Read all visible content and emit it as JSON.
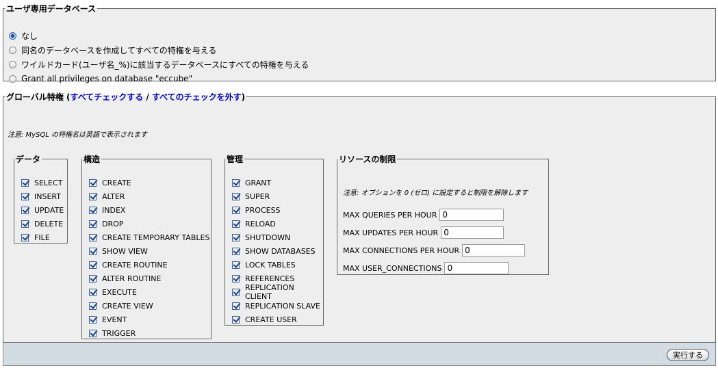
{
  "user_db": {
    "legend": "ユーザ専用データベース",
    "options": [
      {
        "label": "なし",
        "selected": true
      },
      {
        "label": "同名のデータベースを作成してすべての特権を与える",
        "selected": false
      },
      {
        "label": "ワイルドカード(ユーザ名_%)に該当するデータベースにすべての特権を与える",
        "selected": false
      },
      {
        "label": "Grant all privileges on database \"eccube\"",
        "selected": false
      }
    ]
  },
  "global": {
    "legend_prefix": "グローバル特権 (",
    "check_all": "すべてチェックする",
    "separator": " / ",
    "uncheck_all": "すべてのチェックを外す",
    "legend_suffix": ")",
    "note": "注意: MySQL の特権名は英語で表示されます",
    "data": {
      "legend": "データ",
      "items": [
        "SELECT",
        "INSERT",
        "UPDATE",
        "DELETE",
        "FILE"
      ]
    },
    "structure": {
      "legend": "構造",
      "items": [
        "CREATE",
        "ALTER",
        "INDEX",
        "DROP",
        "CREATE TEMPORARY TABLES",
        "SHOW VIEW",
        "CREATE ROUTINE",
        "ALTER ROUTINE",
        "EXECUTE",
        "CREATE VIEW",
        "EVENT",
        "TRIGGER"
      ]
    },
    "admin": {
      "legend": "管理",
      "items": [
        "GRANT",
        "SUPER",
        "PROCESS",
        "RELOAD",
        "SHUTDOWN",
        "SHOW DATABASES",
        "LOCK TABLES",
        "REFERENCES",
        "REPLICATION CLIENT",
        "REPLICATION SLAVE",
        "CREATE USER"
      ]
    },
    "resources": {
      "legend": "リソースの制限",
      "note": "注意: オプションを 0 (ゼロ) に設定すると制限を解除します",
      "rows": [
        {
          "label": "MAX QUERIES PER HOUR",
          "value": "0"
        },
        {
          "label": "MAX UPDATES PER HOUR",
          "value": "0"
        },
        {
          "label": "MAX CONNECTIONS PER HOUR",
          "value": "0"
        },
        {
          "label": "MAX USER_CONNECTIONS",
          "value": "0"
        }
      ]
    }
  },
  "footer": {
    "go_label": "実行する"
  }
}
